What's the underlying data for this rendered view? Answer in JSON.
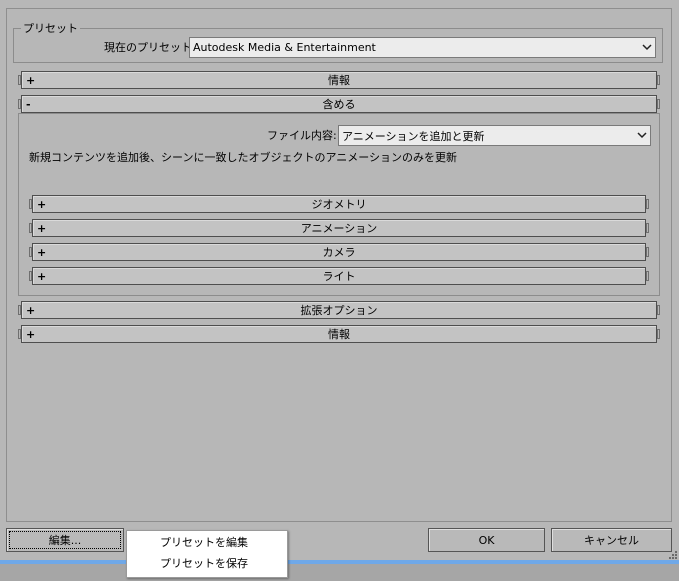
{
  "preset_group": {
    "title": "プリセット",
    "current_label": "現在のプリセット:",
    "current_value": "Autodesk Media & Entertainment"
  },
  "rollouts_top": [
    {
      "sign": "+",
      "label": "情報"
    },
    {
      "sign": "-",
      "label": "含める"
    }
  ],
  "include": {
    "file_content_label": "ファイル内容:",
    "file_content_value": "アニメーションを追加と更新",
    "description": "新規コンテンツを追加後、シーンに一致したオブジェクトのアニメーションのみを更新",
    "sub_rollouts": [
      {
        "sign": "+",
        "label": "ジオメトリ"
      },
      {
        "sign": "+",
        "label": "アニメーション"
      },
      {
        "sign": "+",
        "label": "カメラ"
      },
      {
        "sign": "+",
        "label": "ライト"
      }
    ]
  },
  "rollouts_bottom": [
    {
      "sign": "+",
      "label": "拡張オプション"
    },
    {
      "sign": "+",
      "label": "情報"
    }
  ],
  "buttons": {
    "edit": "編集...",
    "ok": "OK",
    "cancel": "キャンセル"
  },
  "popup_menu": {
    "items": [
      "プリセットを編集",
      "プリセットを保存"
    ]
  },
  "icons": {
    "dropdown_arrow": "chevron-down-icon",
    "resize_grip": "resize-grip-icon"
  }
}
